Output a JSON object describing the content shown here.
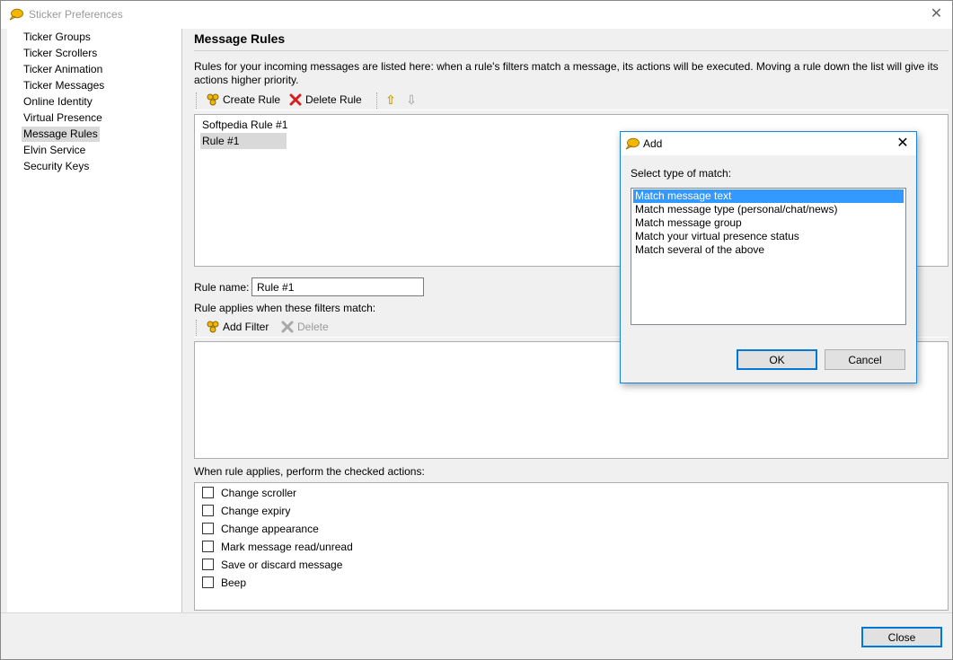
{
  "window": {
    "title": "Sticker Preferences",
    "close_glyph": "✕"
  },
  "sidebar": {
    "items": [
      {
        "label": "Ticker Groups"
      },
      {
        "label": "Ticker Scrollers"
      },
      {
        "label": "Ticker Animation"
      },
      {
        "label": "Ticker Messages"
      },
      {
        "label": "Online Identity"
      },
      {
        "label": "Virtual Presence"
      },
      {
        "label": "Message Rules"
      },
      {
        "label": "Elvin Service"
      },
      {
        "label": "Security Keys"
      }
    ],
    "selected": "Message Rules"
  },
  "main": {
    "title": "Message Rules",
    "description": "Rules for your incoming messages are listed here: when a rule's filters match a message, its actions will be executed. Moving a rule down the list will give its actions higher priority.",
    "toolbar": {
      "create_label": "Create Rule",
      "delete_label": "Delete Rule",
      "up_glyph": "⇧",
      "down_glyph": "⇩"
    },
    "rules": [
      "Softpedia Rule #1",
      "Rule #1"
    ],
    "selected_rule": "Rule #1",
    "rule_name_label": "Rule name:",
    "rule_name_value": "Rule #1",
    "filters_label": "Rule applies when these filters match:",
    "filter_toolbar": {
      "add_label": "Add Filter",
      "delete_label": "Delete"
    },
    "actions_label": "When rule applies, perform the checked actions:",
    "actions": [
      {
        "label": "Change scroller",
        "checked": false
      },
      {
        "label": "Change expiry",
        "checked": false
      },
      {
        "label": "Change appearance",
        "checked": false
      },
      {
        "label": "Mark message read/unread",
        "checked": false
      },
      {
        "label": "Save or discard message",
        "checked": false
      },
      {
        "label": "Beep",
        "checked": false
      }
    ]
  },
  "footer": {
    "close_label": "Close"
  },
  "dialog": {
    "title": "Add",
    "close_glyph": "✕",
    "prompt": "Select type of match:",
    "options": [
      "Match message text",
      "Match message type (personal/chat/news)",
      "Match message group",
      "Match your virtual presence status",
      "Match several of the above"
    ],
    "selected": "Match message text",
    "ok_label": "OK",
    "cancel_label": "Cancel"
  },
  "colors": {
    "accent": "#0078d7",
    "selection": "#3399ff",
    "icon_yellow": "#f2b705",
    "delete_red": "#d81e1e"
  }
}
